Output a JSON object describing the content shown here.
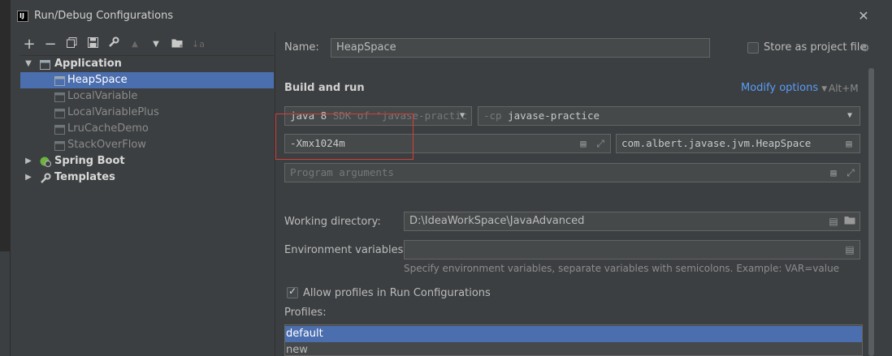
{
  "window": {
    "title": "Run/Debug Configurations",
    "app_icon_text": "IJ"
  },
  "toolbar": {
    "add": "+",
    "remove": "−",
    "copy": "⧉",
    "save": "💾",
    "edit": "🔧",
    "up": "▲",
    "down": "▼",
    "folder": "📁",
    "sort": "↓a"
  },
  "tree": {
    "application": "Application",
    "items": [
      "HeapSpace",
      "LocalVariable",
      "LocalVariablePlus",
      "LruCacheDemo",
      "StackOverFlow"
    ],
    "spring_boot": "Spring Boot",
    "templates": "Templates"
  },
  "form": {
    "name_label": "Name:",
    "name_value": "HeapSpace",
    "store_label": "Store as project file",
    "build_run": "Build and run",
    "modify_options": "Modify options",
    "modify_shortcut": "Alt+M",
    "jdk_value": "java 8",
    "jdk_detail": "SDK of 'javase-practic",
    "cp_prefix": "-cp",
    "cp_value": "javase-practice",
    "vm_options": "-Xmx1024m",
    "main_class": "com.albert.javase.jvm.HeapSpace",
    "program_args_placeholder": "Program arguments",
    "working_dir_label": "Working directory:",
    "working_dir_value": "D:\\IdeaWorkSpace\\JavaAdvanced",
    "env_label": "Environment variables:",
    "env_value": "",
    "env_hint": "Specify environment variables, separate variables with semicolons. Example: VAR=value",
    "allow_profiles_label": "Allow profiles in Run Configurations",
    "profiles_label": "Profiles:",
    "profiles": [
      "default",
      "new"
    ]
  }
}
